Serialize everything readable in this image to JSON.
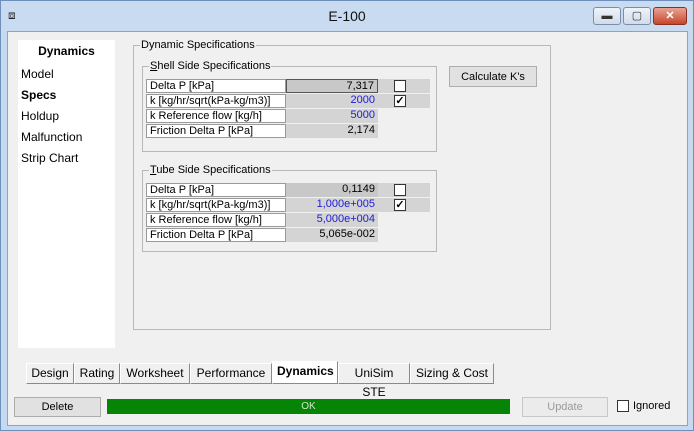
{
  "window": {
    "title": "E-100",
    "controls": {
      "minimize": "▬",
      "maximize": "▢",
      "close": "✕"
    }
  },
  "nav": {
    "heading": "Dynamics",
    "items": [
      {
        "label": "Model"
      },
      {
        "label": "Specs",
        "selected": true
      },
      {
        "label": "Holdup"
      },
      {
        "label": "Malfunction"
      },
      {
        "label": "Strip Chart"
      }
    ]
  },
  "dynamic_specs": {
    "title": "Dynamic Specifications",
    "shell": {
      "title_prefix": "S",
      "title_rest": "hell Side Specifications",
      "rows": [
        {
          "label": "Delta P [kPa]",
          "value": "7,317",
          "checked": false
        },
        {
          "label": "k [kg/hr/sqrt(kPa-kg/m3)]",
          "value": "2000",
          "checked": true
        },
        {
          "label": "k Reference flow [kg/h]",
          "value": "5000"
        },
        {
          "label": "Friction Delta P [kPa]",
          "value": "2,174"
        }
      ]
    },
    "tube": {
      "title_prefix": "T",
      "title_rest": "ube Side Specifications",
      "rows": [
        {
          "label": "Delta P [kPa]",
          "value": "0,1149",
          "checked": false
        },
        {
          "label": "k [kg/hr/sqrt(kPa-kg/m3)]",
          "value": "1,000e+005",
          "checked": true
        },
        {
          "label": "k Reference flow [kg/h]",
          "value": "5,000e+004"
        },
        {
          "label": "Friction Delta P [kPa]",
          "value": "5,065e-002"
        }
      ]
    },
    "calc_button": "Calculate K's"
  },
  "tabs": [
    "Design",
    "Rating",
    "Worksheet",
    "Performance",
    "Dynamics",
    "UniSim STE",
    "Sizing & Cost"
  ],
  "active_tab": "Dynamics",
  "bottom": {
    "delete_label": "Delete",
    "status_text": "OK",
    "update_label": "Update",
    "ignored_label": "Ignored",
    "ignored_checked": false
  },
  "colors": {
    "status_ok": "#068406",
    "specified_value": "#1c1cd6",
    "calc_cell": "#c8c8c8"
  }
}
